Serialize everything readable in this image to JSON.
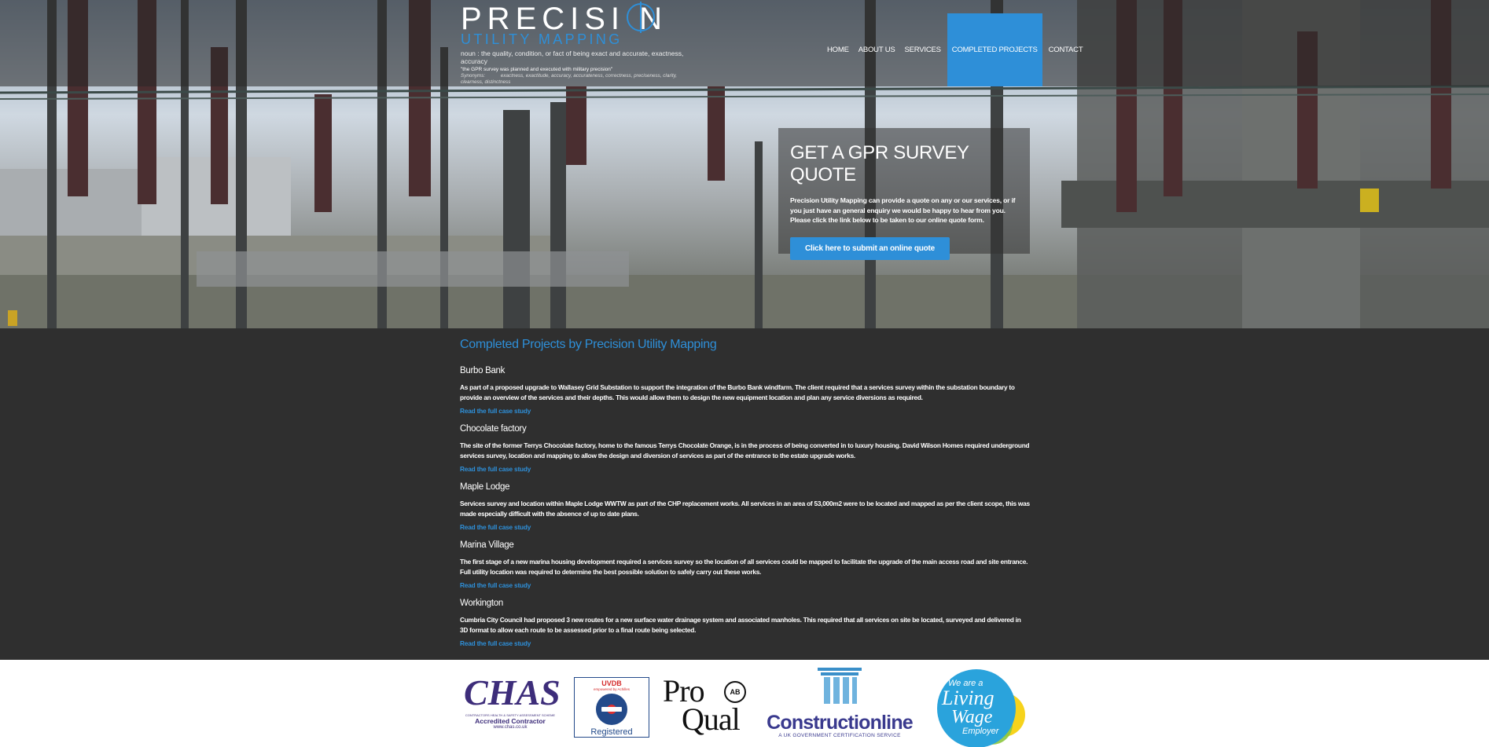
{
  "header": {
    "logo_main": "PRECISI N",
    "logo_sub": "UTILITY MAPPING",
    "logo_definition": "noun : the quality, condition, or fact of being exact and accurate, exactness, accuracy",
    "logo_quote": "\"the GPR survey was planned and executed with military precision\"",
    "logo_synonyms_label": "Synonyms:",
    "logo_synonyms": "exactness, exactitude, accuracy, accurateness, correctness, preciseness, clarity, clearness, distinctness",
    "nav": [
      {
        "label": "HOME"
      },
      {
        "label": "ABOUT US"
      },
      {
        "label": "SERVICES"
      },
      {
        "label": "COMPLETED PROJECTS"
      },
      {
        "label": "CONTACT"
      }
    ]
  },
  "quote": {
    "title": "GET A GPR SURVEY QUOTE",
    "text": "Precision Utility Mapping can provide a quote on any or our services, or if you just have an general enquiry we would be happy to hear from you. Please click the link below to be taken to our online quote form.",
    "button": "Click here to submit an online quote"
  },
  "content": {
    "title": "Completed Projects by Precision Utility Mapping",
    "projects": [
      {
        "name": "Burbo Bank",
        "description": "As part of a proposed upgrade to Wallasey Grid Substation to support the integration of the Burbo Bank windfarm. The client required that a services survey within the substation boundary to provide an overview of the services and their depths. This would allow them to design the new equipment location and plan any service diversions as required.",
        "link": "Read the full case study"
      },
      {
        "name": "Chocolate factory",
        "description": "The site of the former Terrys Chocolate factory, home to the famous Terrys Chocolate Orange, is in the process of being converted in to luxury housing. David Wilson Homes required underground services survey, location and mapping to allow the design and diversion of services as part of the entrance to the estate upgrade works.",
        "link": "Read the full case study"
      },
      {
        "name": "Maple Lodge",
        "description": "Services survey and location within Maple Lodge WWTW as part of the CHP replacement works. All services in an area of 53,000m2 were to be located and mapped as per the client scope, this was made especially difficult with the absence of up to date plans.",
        "link": "Read the full case study"
      },
      {
        "name": "Marina Village",
        "description": "The first stage of a new marina housing development required a services survey so the location of all services could be mapped to facilitate the upgrade of the main access road and site entrance. Full utility location was required to determine the best possible solution to safely carry out these works.",
        "link": "Read the full case study"
      },
      {
        "name": "Workington",
        "description": "Cumbria City Council had proposed 3 new routes for a new surface water drainage system and associated manholes. This required that all services on site be located, surveyed and delivered in 3D format to allow each route to be assessed prior to a final route being selected.",
        "link": "Read the full case study"
      }
    ]
  },
  "footer": {
    "chas": {
      "big": "CHAS",
      "small": "CONTRACTORS HEALTH & SAFETY ASSESSMENT SCHEME",
      "accredited": "Accredited Contractor",
      "url": "www.chas.co.uk"
    },
    "uvdb": {
      "title": "UVDB",
      "sub": "empowered by Achilles",
      "registered": "Registered"
    },
    "proqual": {
      "pro": "Pro",
      "qual": "Qual",
      "badge": "AB"
    },
    "constructionline": {
      "name": "Constructionline",
      "tag": "A UK GOVERNMENT CERTIFICATION SERVICE"
    },
    "livingwage": {
      "line1": "We are a",
      "line2": "Living",
      "line3": "Wage",
      "line4": "Employer"
    }
  },
  "colors": {
    "accent": "#2e8fd8",
    "background": "#2f2f2f",
    "footer": "#ffffff"
  }
}
